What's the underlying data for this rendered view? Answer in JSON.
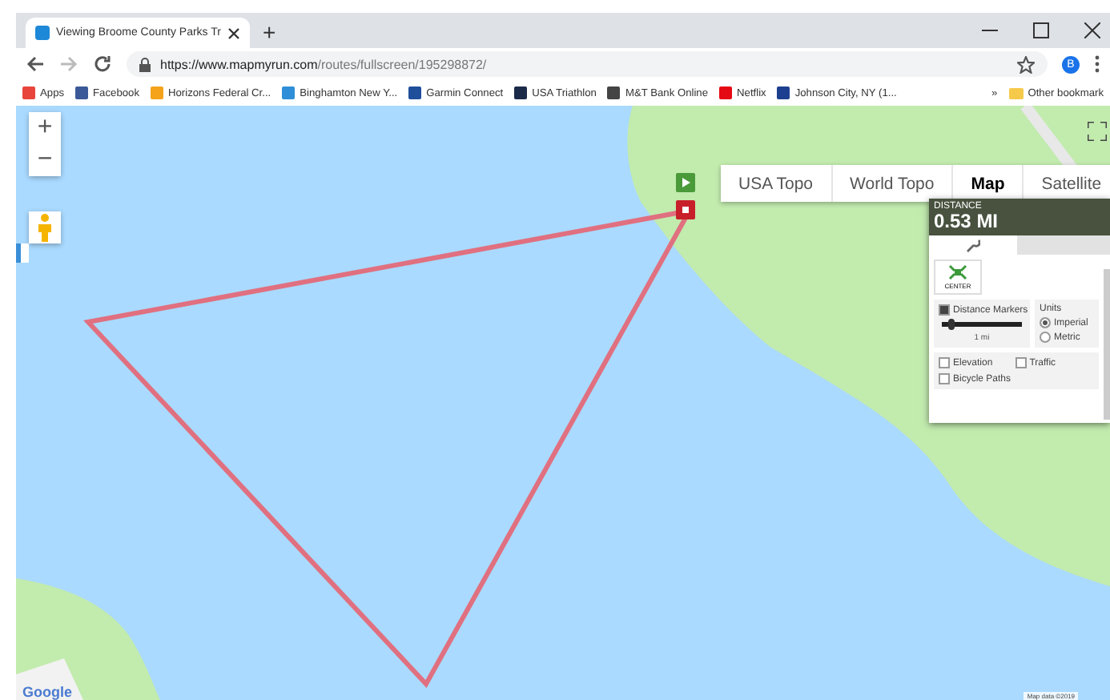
{
  "browser": {
    "tab_title": "Viewing Broome County Parks Tr",
    "new_tab": "+",
    "url_host": "https://www.mapmyrun.com",
    "url_path": "/routes/fullscreen/195298872/",
    "profile": "B",
    "bookmarks": [
      {
        "label": "Apps",
        "color": "#e8453c"
      },
      {
        "label": "Facebook",
        "color": "#3b5998"
      },
      {
        "label": "Horizons Federal Cr...",
        "color": "#f4a31b"
      },
      {
        "label": "Binghamton New Y...",
        "color": "#2e8fd8"
      },
      {
        "label": "Garmin Connect",
        "color": "#1f4e9b"
      },
      {
        "label": "USA Triathlon",
        "color": "#1c2a4a"
      },
      {
        "label": "M&T Bank Online",
        "color": "#444444"
      },
      {
        "label": "Netflix",
        "color": "#e50914"
      },
      {
        "label": "Johnson City, NY (1...",
        "color": "#1d3f8f"
      }
    ],
    "overflow": "»",
    "other_bookmarks": "Other bookmark"
  },
  "map": {
    "map_types": [
      {
        "label": "USA Topo",
        "selected": false
      },
      {
        "label": "World Topo",
        "selected": false
      },
      {
        "label": "Map",
        "selected": true
      },
      {
        "label": "Satellite",
        "selected": false
      }
    ],
    "zoom_in": "+",
    "zoom_out": "−",
    "logo": "Google",
    "attribution": "Map data ©2019"
  },
  "distance_panel": {
    "label": "DISTANCE",
    "value": "0.53 MI",
    "center_button": "CENTER",
    "distance_markers": {
      "label": "Distance Markers",
      "checked": true,
      "level": 0.08,
      "reading": "1 mi"
    },
    "units": {
      "label": "Units",
      "options": [
        {
          "label": "Imperial",
          "selected": true
        },
        {
          "label": "Metric",
          "selected": false
        }
      ]
    },
    "layers": [
      {
        "label": "Elevation",
        "checked": false
      },
      {
        "label": "Traffic",
        "checked": false
      },
      {
        "label": "Bicycle Paths",
        "checked": false
      }
    ]
  }
}
